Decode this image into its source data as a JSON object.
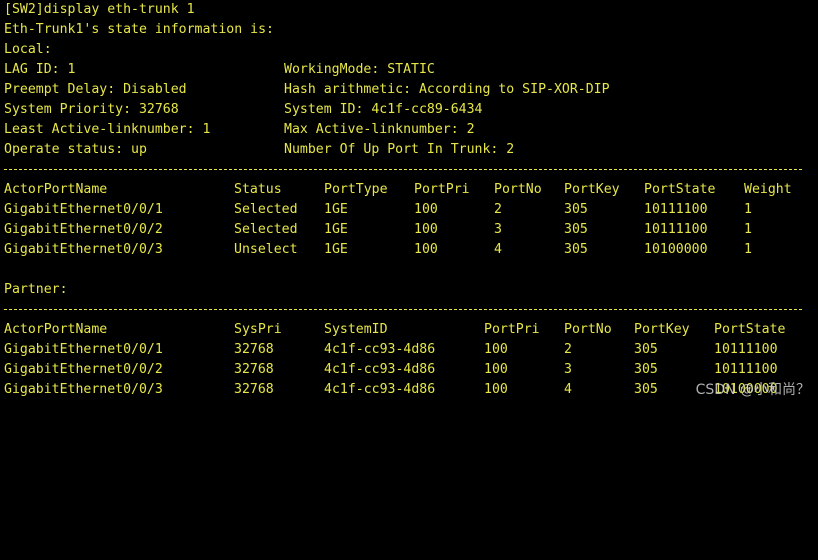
{
  "terminal": {
    "command": "[SW2]display eth-trunk 1",
    "header": "Eth-Trunk1's state information is:",
    "local_label": "Local:",
    "lag_id": "LAG ID: 1",
    "working_mode": "WorkingMode: STATIC",
    "preempt_delay": "Preempt Delay: Disabled",
    "hash_arithmetic": "Hash arithmetic: According to SIP-XOR-DIP",
    "system_priority": "System Priority: 32768",
    "system_id": "System ID: 4c1f-cc89-6434",
    "least_active": "Least Active-linknumber: 1",
    "max_active": "Max Active-linknumber: 2",
    "operate_status": "Operate status: up",
    "up_ports": "Number Of Up Port In Trunk: 2",
    "actor_columns": [
      "ActorPortName",
      "Status",
      "PortType",
      "PortPri",
      "PortNo",
      "PortKey",
      "PortState",
      "Weight"
    ],
    "actor_rows": [
      [
        "GigabitEthernet0/0/1",
        "Selected",
        "1GE",
        "100",
        "2",
        "305",
        "10111100",
        "1"
      ],
      [
        "GigabitEthernet0/0/2",
        "Selected",
        "1GE",
        "100",
        "3",
        "305",
        "10111100",
        "1"
      ],
      [
        "GigabitEthernet0/0/3",
        "Unselect",
        "1GE",
        "100",
        "4",
        "305",
        "10100000",
        "1"
      ]
    ],
    "partner_label": "Partner:",
    "partner_columns": [
      "ActorPortName",
      "SysPri",
      "SystemID",
      "PortPri",
      "PortNo",
      "PortKey",
      "PortState"
    ],
    "partner_rows": [
      [
        "GigabitEthernet0/0/1",
        "32768",
        "4c1f-cc93-4d86",
        "100",
        "2",
        "305",
        "10111100"
      ],
      [
        "GigabitEthernet0/0/2",
        "32768",
        "4c1f-cc93-4d86",
        "100",
        "3",
        "305",
        "10111100"
      ],
      [
        "GigabitEthernet0/0/3",
        "32768",
        "4c1f-cc93-4d86",
        "100",
        "4",
        "305",
        "10100000"
      ]
    ]
  },
  "watermark": "CSDN @小和尚？",
  "colors": {
    "background": "#000000",
    "text": "#e6e64a"
  }
}
